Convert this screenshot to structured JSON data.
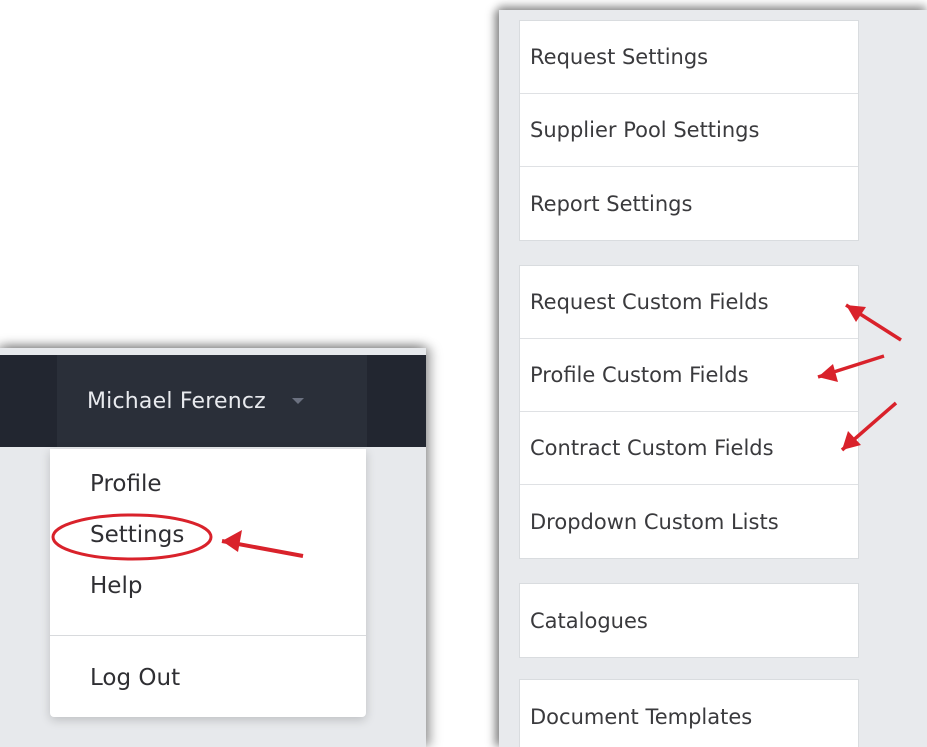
{
  "user_menu": {
    "user_name": "Michael Ferencz",
    "items": [
      {
        "label": "Profile"
      },
      {
        "label": "Settings"
      },
      {
        "label": "Help"
      },
      {
        "label": "Log Out"
      }
    ]
  },
  "settings_menu": {
    "groups": [
      {
        "items": [
          {
            "label": "Request Settings"
          },
          {
            "label": "Supplier Pool Settings"
          },
          {
            "label": "Report Settings"
          }
        ]
      },
      {
        "items": [
          {
            "label": "Request Custom Fields"
          },
          {
            "label": "Profile Custom Fields"
          },
          {
            "label": "Contract Custom Fields"
          },
          {
            "label": "Dropdown Custom Lists"
          }
        ]
      },
      {
        "items": [
          {
            "label": "Catalogues"
          }
        ]
      },
      {
        "items": [
          {
            "label": "Document Templates"
          }
        ]
      }
    ]
  },
  "colors": {
    "navbar": "#222630",
    "annotation_red": "#d9222b"
  }
}
